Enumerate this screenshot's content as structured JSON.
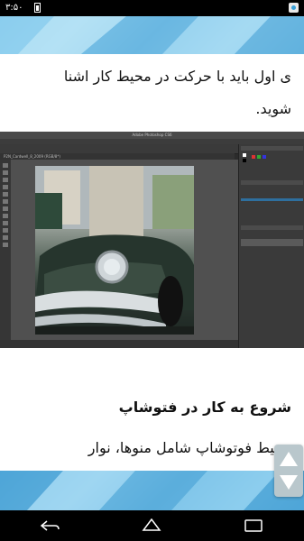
{
  "status": {
    "time": "۳:۵۰",
    "battery_icon": "battery-icon",
    "app_icon": "app-icon"
  },
  "article": {
    "line1": "ی اول باید با حرکت در محیط کار اشنا",
    "line2": "شوید.",
    "heading": "شروع به کار در فتوشاپ",
    "line3": "محیط فوتوشاپ شامل منوها، نوار"
  },
  "screenshot": {
    "window_title": "Adobe Photoshop CS6",
    "tab_label": "P2N_Cardwell_8_2009 (RGB/8*)"
  },
  "nav": {
    "back_icon": "back-icon",
    "home_icon": "home-icon",
    "recents_icon": "recents-icon"
  },
  "scroll_thumb_icon": "scroll-thumb-icon",
  "colors": {
    "banner": "#7cc3e8",
    "thumb": "#b9c7cc"
  }
}
